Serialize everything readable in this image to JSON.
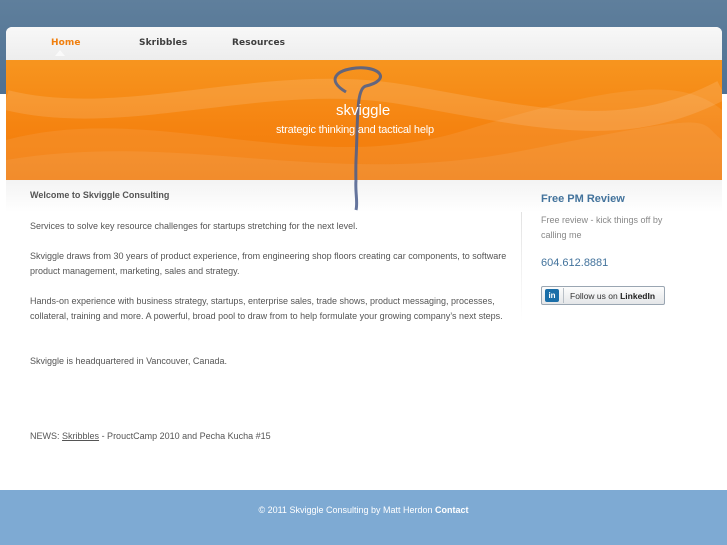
{
  "nav": {
    "items": [
      {
        "label": "Home",
        "active": true
      },
      {
        "label": "Skribbles",
        "active": false
      },
      {
        "label": "Resources",
        "active": false
      }
    ]
  },
  "banner": {
    "logo": "skviggle",
    "tagline": "strategic thinking and tactical help"
  },
  "main": {
    "heading": "Welcome to Skviggle Consulting",
    "paragraphs": [
      "Services to solve key resource challenges for startups stretching for the next level.",
      "Skviggle draws from 30 years of product experience, from engineering shop floors creating car components, to software product management, marketing, sales and strategy.",
      "Hands-on experience with business strategy, startups, enterprise sales, trade shows, product messaging, processes, collateral, training and more. A powerful, broad pool to draw from to help formulate your growing company’s next steps.",
      "Skviggle is headquartered in Vancouver, Canada."
    ],
    "news_prefix": "NEWS:",
    "news_link": "Skribbles",
    "news_suffix": "- ProuctCamp 2010 and Pecha Kucha #15"
  },
  "sidebar": {
    "title": "Free PM Review",
    "text": "Free review - kick things off by calling me",
    "phone": "604.612.8881",
    "linkedin_icon_text": "in",
    "linkedin_label": "Follow us on",
    "linkedin_brand": "LinkedIn"
  },
  "footer": {
    "text": "© 2011 Skviggle Consulting by Matt Herdon",
    "contact_link": "Contact"
  },
  "colors": {
    "accent_orange": "#f5820f",
    "header_blue": "#5f7f9c",
    "footer_blue": "#7eaad3",
    "link_blue": "#43739c"
  }
}
